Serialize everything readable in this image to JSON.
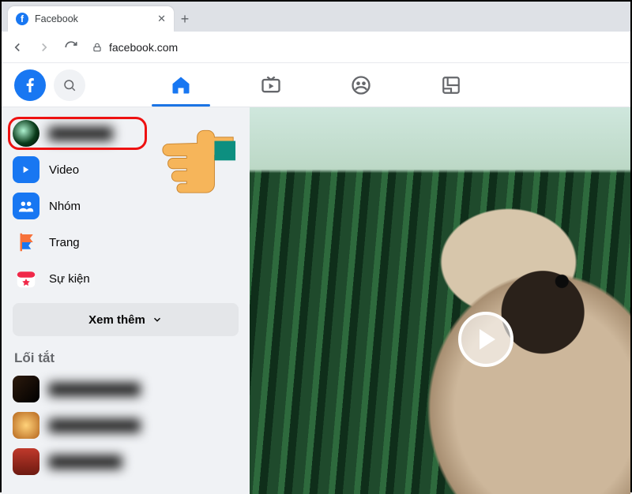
{
  "browser": {
    "tab_title": "Facebook",
    "url_display": "facebook.com"
  },
  "sidebar": {
    "profile_name": "███████",
    "items": [
      {
        "label": "Video"
      },
      {
        "label": "Nhóm"
      },
      {
        "label": "Trang"
      },
      {
        "label": "Sự kiện"
      }
    ],
    "see_more_label": "Xem thêm",
    "shortcuts_title": "Lối tắt",
    "shortcuts": [
      {
        "label": "██████████"
      },
      {
        "label": "██████████"
      },
      {
        "label": "████████"
      }
    ]
  },
  "icons": {
    "home": "home-icon",
    "watch": "watch-icon",
    "groups": "groups-icon",
    "gaming": "gaming-icon"
  },
  "colors": {
    "fb_blue": "#1877f2",
    "highlight_red": "#e11"
  },
  "annotation": {
    "highlight_target": "profile-row",
    "pointer_icon": "pointing-hand-icon"
  },
  "feed": {
    "media_type": "video",
    "play_button": true,
    "subject": "dog (pug) in front of pine trees"
  }
}
